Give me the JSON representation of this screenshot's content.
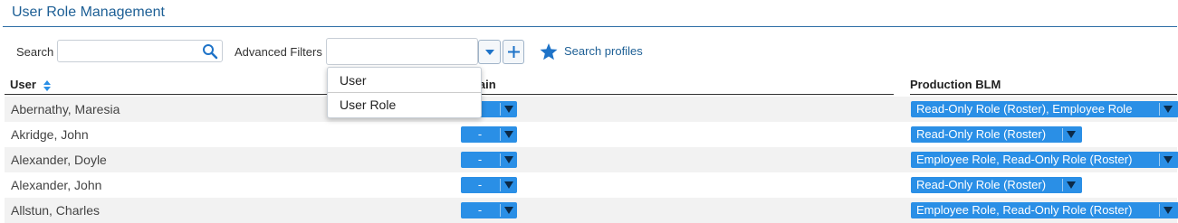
{
  "page": {
    "title": "User Role Management"
  },
  "toolbar": {
    "search_label": "Search",
    "search_value": "",
    "advanced_filters_label": "Advanced Filters",
    "advanced_filters_value": "",
    "search_profiles_label": "Search profiles"
  },
  "filter_menu": {
    "items": [
      "User",
      "User Role"
    ]
  },
  "table": {
    "columns": [
      "User",
      "Domain",
      "Production BLM"
    ],
    "sort": {
      "column": "User",
      "icon": "sort-icon"
    },
    "rows": [
      {
        "user": "Abernathy, Maresia",
        "domain": "-",
        "blm": "Read-Only Role (Roster), Employee Role"
      },
      {
        "user": "Akridge, John",
        "domain": "-",
        "blm": "Read-Only Role (Roster)"
      },
      {
        "user": "Alexander, Doyle",
        "domain": "-",
        "blm": "Employee Role, Read-Only Role (Roster)"
      },
      {
        "user": "Alexander, John",
        "domain": "-",
        "blm": "Read-Only Role (Roster)"
      },
      {
        "user": "Allstun, Charles",
        "domain": "-",
        "blm": "Employee Role, Read-Only Role (Roster)"
      }
    ]
  },
  "colors": {
    "accent": "#2a8fe6",
    "title": "#1d5f95",
    "row_alt": "#f2f2f2"
  },
  "icons": [
    "search-icon",
    "chevron-down-icon",
    "plus-icon",
    "star-icon",
    "sort-icon"
  ]
}
